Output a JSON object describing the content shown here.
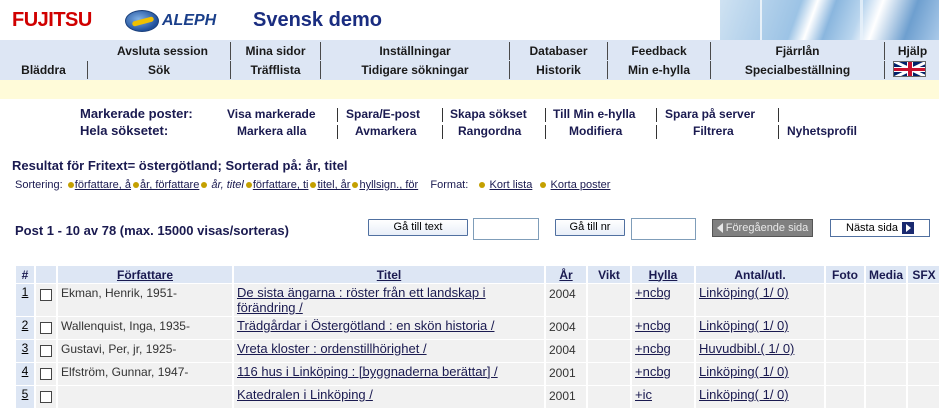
{
  "header": {
    "brand": "FUJITSU",
    "aleph": "ALEPH",
    "title": "Svensk demo"
  },
  "menu": {
    "row1": [
      "Avsluta session",
      "Mina sidor",
      "Inställningar",
      "Databaser",
      "Feedback",
      "Fjärrlån",
      "Hjälp"
    ],
    "row2": [
      "Bläddra",
      "Sök",
      "Träfflista",
      "Tidigare sökningar",
      "Historik",
      "Min e-hylla",
      "Specialbeställning"
    ]
  },
  "actions": {
    "marked_label": "Markerade poster:",
    "marked": [
      "Visa markerade",
      "Spara/E-post",
      "Skapa sökset",
      "Till Min e-hylla",
      "Spara på server"
    ],
    "set_label": "Hela söksetet:",
    "set": [
      "Markera alla",
      "Avmarkera",
      "Rangordna",
      "Modifiera",
      "Filtrera",
      "Nyhetsprofil"
    ]
  },
  "result": {
    "title": "Resultat för Fritext= östergötland;   Sorterad på: år, titel",
    "sort_label": "Sortering:",
    "sort_options": [
      "författare, å",
      "år, författare",
      "år, titel",
      "författare, ti",
      "titel, år",
      "hyllsign., för"
    ],
    "format_label": "Format:",
    "format_options": [
      "Kort lista",
      "Korta poster"
    ]
  },
  "paging": {
    "info": "Post 1 - 10 av 78 (max. 15000 visas/sorteras)",
    "goto_text": "Gå till text",
    "goto_nr": "Gå till nr",
    "prev": "Föregående sida",
    "next": "Nästa sida"
  },
  "table": {
    "headers": [
      "#",
      "",
      "Författare",
      "Titel",
      "År",
      "Vikt",
      "Hylla",
      "Antal/utl.",
      "Foto",
      "Media",
      "SFX"
    ],
    "rows": [
      {
        "num": "1",
        "author": "Ekman, Henrik, 1951-",
        "title": "De sista ängarna : röster från ett landskap i förändring /",
        "year": "2004",
        "shelf": "+ncbg",
        "holdings": "Linköping( 1/ 0)"
      },
      {
        "num": "2",
        "author": "Wallenquist, Inga, 1935-",
        "title": "Trädgårdar i Östergötland : en skön historia /",
        "year": "2004",
        "shelf": "+ncbg",
        "holdings": "Linköping( 1/ 0)"
      },
      {
        "num": "3",
        "author": "Gustavi, Per, jr, 1925-",
        "title": "Vreta kloster : ordenstillhörighet /",
        "year": "2004",
        "shelf": "+ncbg",
        "holdings": "Huvudbibl.( 1/ 0)"
      },
      {
        "num": "4",
        "author": "Elfström, Gunnar, 1947-",
        "title": "116 hus i Linköping : [byggnaderna berättar] /",
        "year": "2001",
        "shelf": "+ncbg",
        "holdings": "Linköping( 1/ 0)"
      },
      {
        "num": "5",
        "author": "",
        "title": "Katedralen i Linköping /",
        "year": "2001",
        "shelf": "+ic",
        "holdings": "Linköping( 1/ 0)"
      }
    ]
  }
}
